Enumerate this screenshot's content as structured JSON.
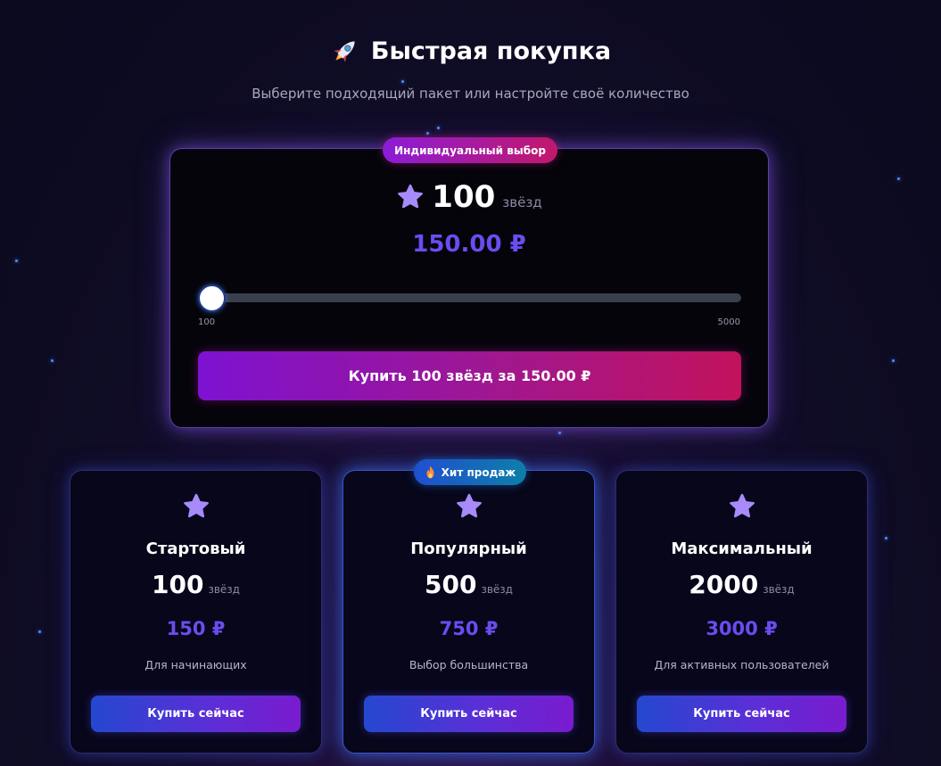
{
  "header": {
    "icon": "rocket-icon",
    "title": "Быстрая покупка",
    "subtitle": "Выберите подходящий пакет или настройте своё количество"
  },
  "custom": {
    "badge": "Индивидуальный выбор",
    "amount": "100",
    "unit": "звёзд",
    "price": "150.00 ₽",
    "slider": {
      "min_label": "100",
      "max_label": "5000",
      "value": 100
    },
    "buy_label": "Купить 100 звёзд за 150.00 ₽"
  },
  "packages": [
    {
      "name": "Стартовый",
      "count": "100",
      "unit": "звёзд",
      "price": "150 ₽",
      "description": "Для начинающих",
      "buy_label": "Купить сейчас"
    },
    {
      "name": "Популярный",
      "count": "500",
      "unit": "звёзд",
      "price": "750 ₽",
      "description": "Выбор большинства",
      "buy_label": "Купить сейчас",
      "badge": "Хит продаж",
      "badge_icon": "fire-icon"
    },
    {
      "name": "Максимальный",
      "count": "2000",
      "unit": "звёзд",
      "price": "3000 ₽",
      "description": "Для активных пользователей",
      "buy_label": "Купить сейчас"
    }
  ],
  "colors": {
    "accent_price": "#6b4cf0",
    "star_icon": "#a78bfa",
    "background": "#0d0b22"
  }
}
